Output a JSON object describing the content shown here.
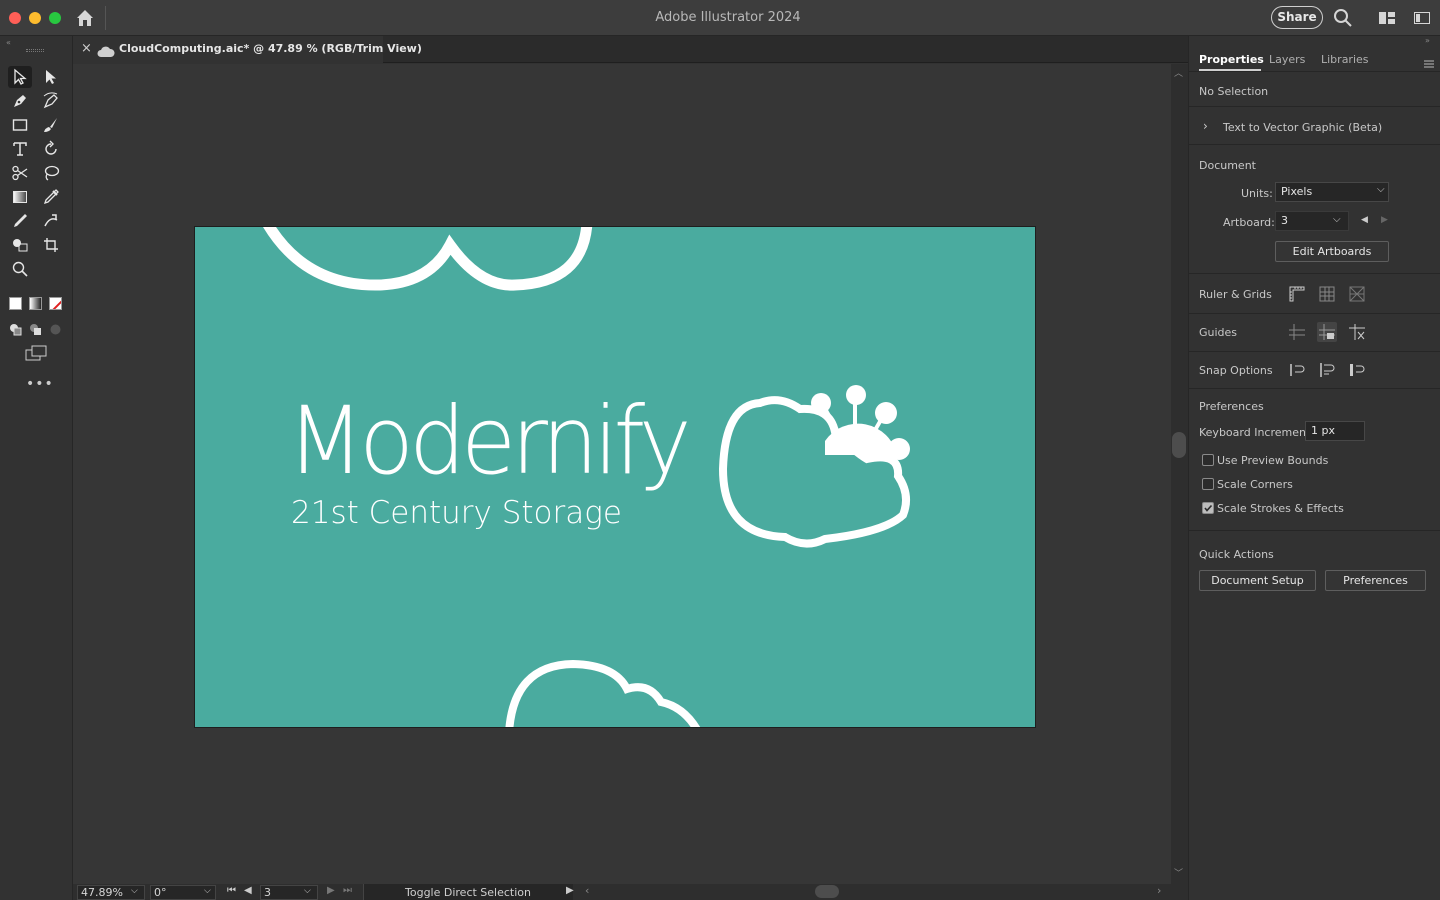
{
  "app": {
    "title": "Adobe Illustrator 2024",
    "share_label": "Share"
  },
  "document_tab": {
    "title": "CloudComputing.aic* @ 47.89 % (RGB/Trim View)",
    "close": "×"
  },
  "artboard": {
    "background_color": "#4aab9f",
    "brand_name": "Modernify",
    "tagline": "21st Century Storage"
  },
  "status_bar": {
    "zoom": "47.89%",
    "rotation": "0°",
    "artboard_number": "3",
    "status_text": "Toggle Direct Selection"
  },
  "properties_panel": {
    "tabs": [
      "Properties",
      "Layers",
      "Libraries"
    ],
    "selection_label": "No Selection",
    "text_to_vector": "Text to Vector Graphic (Beta)",
    "document_heading": "Document",
    "units_label": "Units:",
    "units_value": "Pixels",
    "artboard_label": "Artboard:",
    "artboard_value": "3",
    "edit_artboards": "Edit Artboards",
    "ruler_grids": "Ruler & Grids",
    "guides": "Guides",
    "snap_options": "Snap Options",
    "preferences_heading": "Preferences",
    "keyboard_increment_label": "Keyboard Increment:",
    "keyboard_increment_value": "1 px",
    "use_preview_bounds": "Use Preview Bounds",
    "scale_corners": "Scale Corners",
    "scale_strokes": "Scale Strokes & Effects",
    "quick_actions": "Quick Actions",
    "document_setup": "Document Setup",
    "preferences_button": "Preferences"
  }
}
